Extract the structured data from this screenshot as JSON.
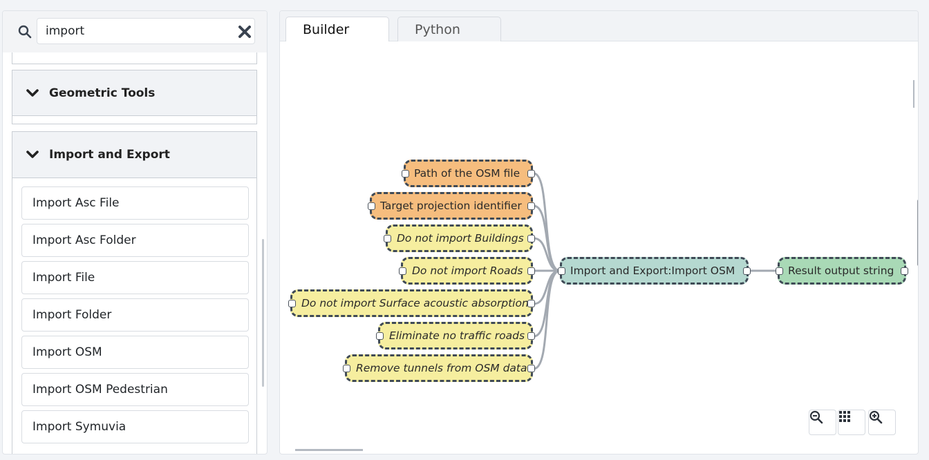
{
  "search": {
    "value": "import",
    "placeholder": "Search..."
  },
  "categories": [
    {
      "title": "Geometric Tools",
      "expanded": true
    },
    {
      "title": "Import and Export",
      "expanded": true,
      "items": [
        {
          "label": "Import Asc File"
        },
        {
          "label": "Import Asc Folder"
        },
        {
          "label": "Import File"
        },
        {
          "label": "Import Folder"
        },
        {
          "label": "Import OSM"
        },
        {
          "label": "Import OSM Pedestrian"
        },
        {
          "label": "Import Symuvia"
        }
      ]
    }
  ],
  "tabs": [
    {
      "label": "Builder",
      "active": true
    },
    {
      "label": "Python",
      "active": false
    }
  ],
  "graph": {
    "inputs": [
      {
        "label": "Path of the OSM file",
        "kind": "required"
      },
      {
        "label": "Target projection identifier",
        "kind": "required"
      },
      {
        "label": "Do not import Buildings",
        "kind": "optional"
      },
      {
        "label": "Do not import Roads",
        "kind": "optional"
      },
      {
        "label": "Do not import Surface acoustic absorption",
        "kind": "optional"
      },
      {
        "label": "Eliminate no traffic roads",
        "kind": "optional"
      },
      {
        "label": "Remove tunnels from OSM data",
        "kind": "optional"
      }
    ],
    "process": {
      "label": "Import and Export:Import OSM"
    },
    "output": {
      "label": "Result output string"
    }
  },
  "colors": {
    "required": "#f6bd7e",
    "optional": "#f6ee9f",
    "process": "#b5d8d0",
    "output": "#a9d9b6",
    "node_border": "#3f4a56",
    "edge": "#a3a9b1"
  },
  "icons": {
    "search": "magnifier",
    "clear": "times",
    "chevron": "chevron-down",
    "zoom_out": "zoom-out",
    "fit": "grid",
    "zoom_in": "zoom-in"
  }
}
